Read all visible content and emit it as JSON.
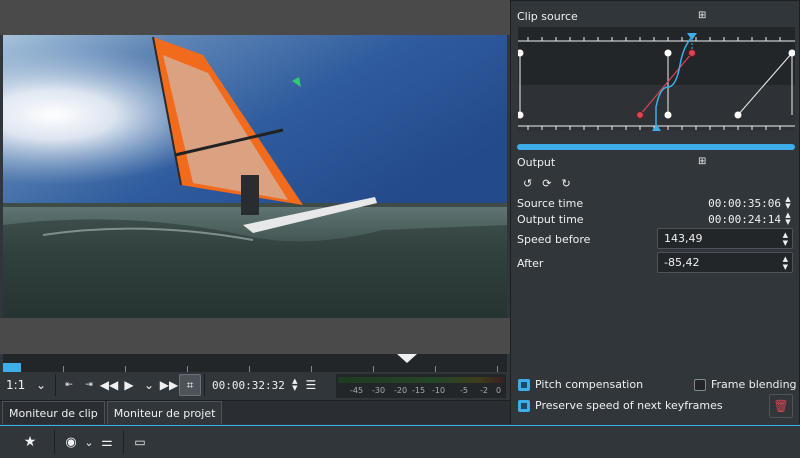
{
  "colors": {
    "accent": "#3daee9",
    "panel_bg": "#31363b",
    "dark_bg": "#232629",
    "danger": "#da4453"
  },
  "monitor": {
    "zoom": "1:1",
    "timecode": "00:00:32:32",
    "vu_labels": [
      "-45",
      "-30",
      "-20",
      "-15",
      "-10",
      "-5",
      "-2",
      "0"
    ],
    "icons": [
      "chevron-down-icon",
      "zone-in-icon",
      "zone-out-icon",
      "rewind-icon",
      "play-icon",
      "fast-forward-icon",
      "crop-icon",
      "menu-icon"
    ]
  },
  "tabs": [
    {
      "label": "Moniteur de clip",
      "active": false
    },
    {
      "label": "Moniteur de projet",
      "active": true
    }
  ],
  "speed_panel": {
    "clip_source_label": "Clip source",
    "output_label": "Output",
    "source_time_label": "Source time",
    "source_time": "00:00:35:06",
    "output_time_label": "Output time",
    "output_time": "00:00:24:14",
    "speed_before_label": "Speed before",
    "speed_before": "143,49",
    "after_label": "After",
    "after": "-85,42",
    "pitch_compensation_label": "Pitch compensation",
    "pitch_compensation": true,
    "frame_blending_label": "Frame blending",
    "frame_blending": false,
    "preserve_speed_label": "Preserve speed of next keyframes",
    "preserve_speed": true
  }
}
